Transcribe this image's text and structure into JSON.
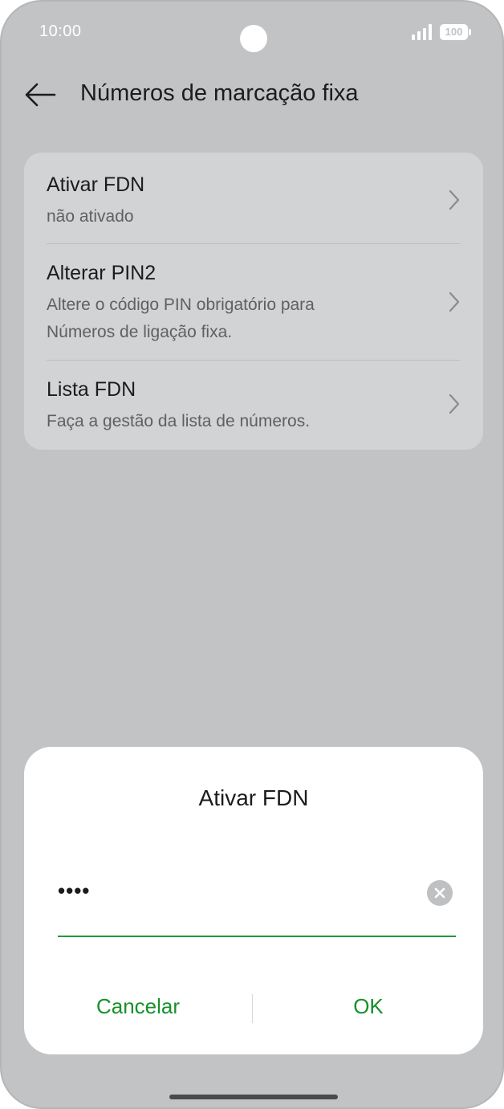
{
  "status_bar": {
    "time": "10:00",
    "battery_level": "100",
    "signal_icon": "signal-bars-icon",
    "battery_icon": "battery-icon"
  },
  "header": {
    "back_icon": "arrow-left-icon",
    "title": "Números de marcação fixa"
  },
  "settings": {
    "items": [
      {
        "title": "Ativar FDN",
        "subtitle": [
          "não ativado"
        ],
        "icon": "chevron-right-icon"
      },
      {
        "title": "Alterar PIN2",
        "subtitle": [
          "Altere o código PIN obrigatório para",
          "Números de ligação fixa."
        ],
        "icon": "chevron-right-icon"
      },
      {
        "title": "Lista FDN",
        "subtitle": [
          "Faça a gestão da lista de números."
        ],
        "icon": "chevron-right-icon"
      }
    ]
  },
  "dialog": {
    "title": "Ativar FDN",
    "pin_value": "••••",
    "clear_icon": "clear-x-icon",
    "cancel_label": "Cancelar",
    "ok_label": "OK"
  },
  "colors": {
    "accent": "#169129",
    "scrim_background": "#c2c3c5",
    "card_background": "#d2d3d4",
    "dialog_background": "#ffffff"
  }
}
